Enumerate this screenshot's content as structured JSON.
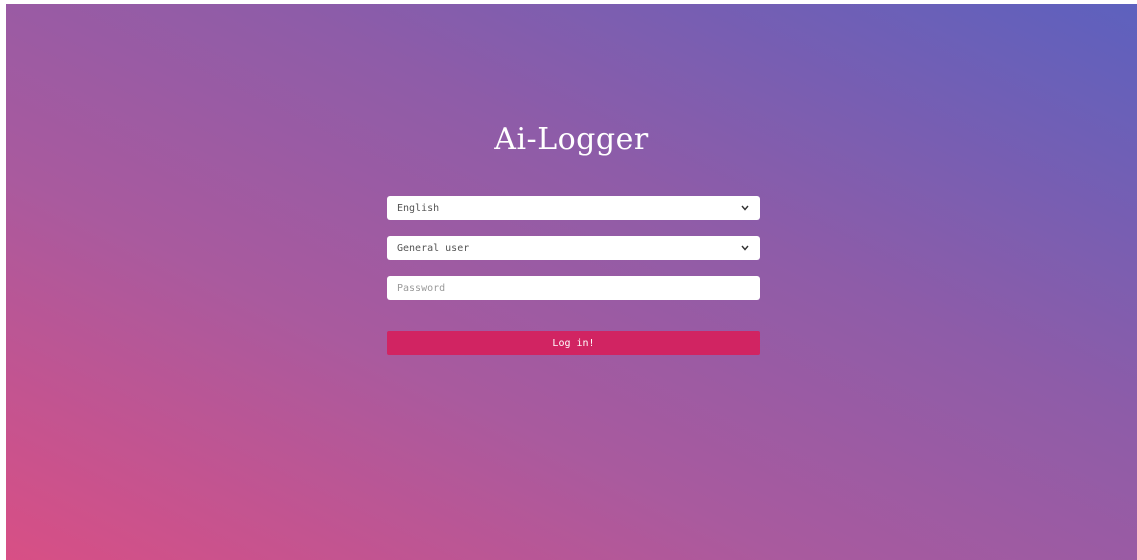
{
  "app": {
    "title": "Ai-Logger"
  },
  "form": {
    "language": {
      "selected": "English",
      "icon": "chevron-down-icon"
    },
    "role": {
      "selected": "General user",
      "icon": "chevron-down-icon"
    },
    "password": {
      "value": "",
      "placeholder": "Password"
    },
    "submit_label": "Log in!"
  },
  "colors": {
    "gradient_start": "#d84f85",
    "gradient_end": "#5d61be",
    "button": "#d12462",
    "field_bg": "#ffffff"
  }
}
